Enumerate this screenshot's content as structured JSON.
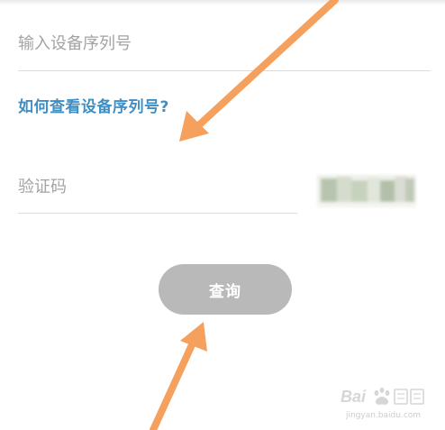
{
  "form": {
    "serial_placeholder": "输入设备序列号",
    "help_link": "如何查看设备序列号?",
    "captcha_placeholder": "验证码",
    "query_button_label": "查询"
  },
  "watermark": {
    "url": "jingyan.baidu.com"
  },
  "colors": {
    "link": "#3f8fc5",
    "button_disabled": "#b9b9b9",
    "arrow": "#f5a05d",
    "divider": "#dcdcdc"
  }
}
